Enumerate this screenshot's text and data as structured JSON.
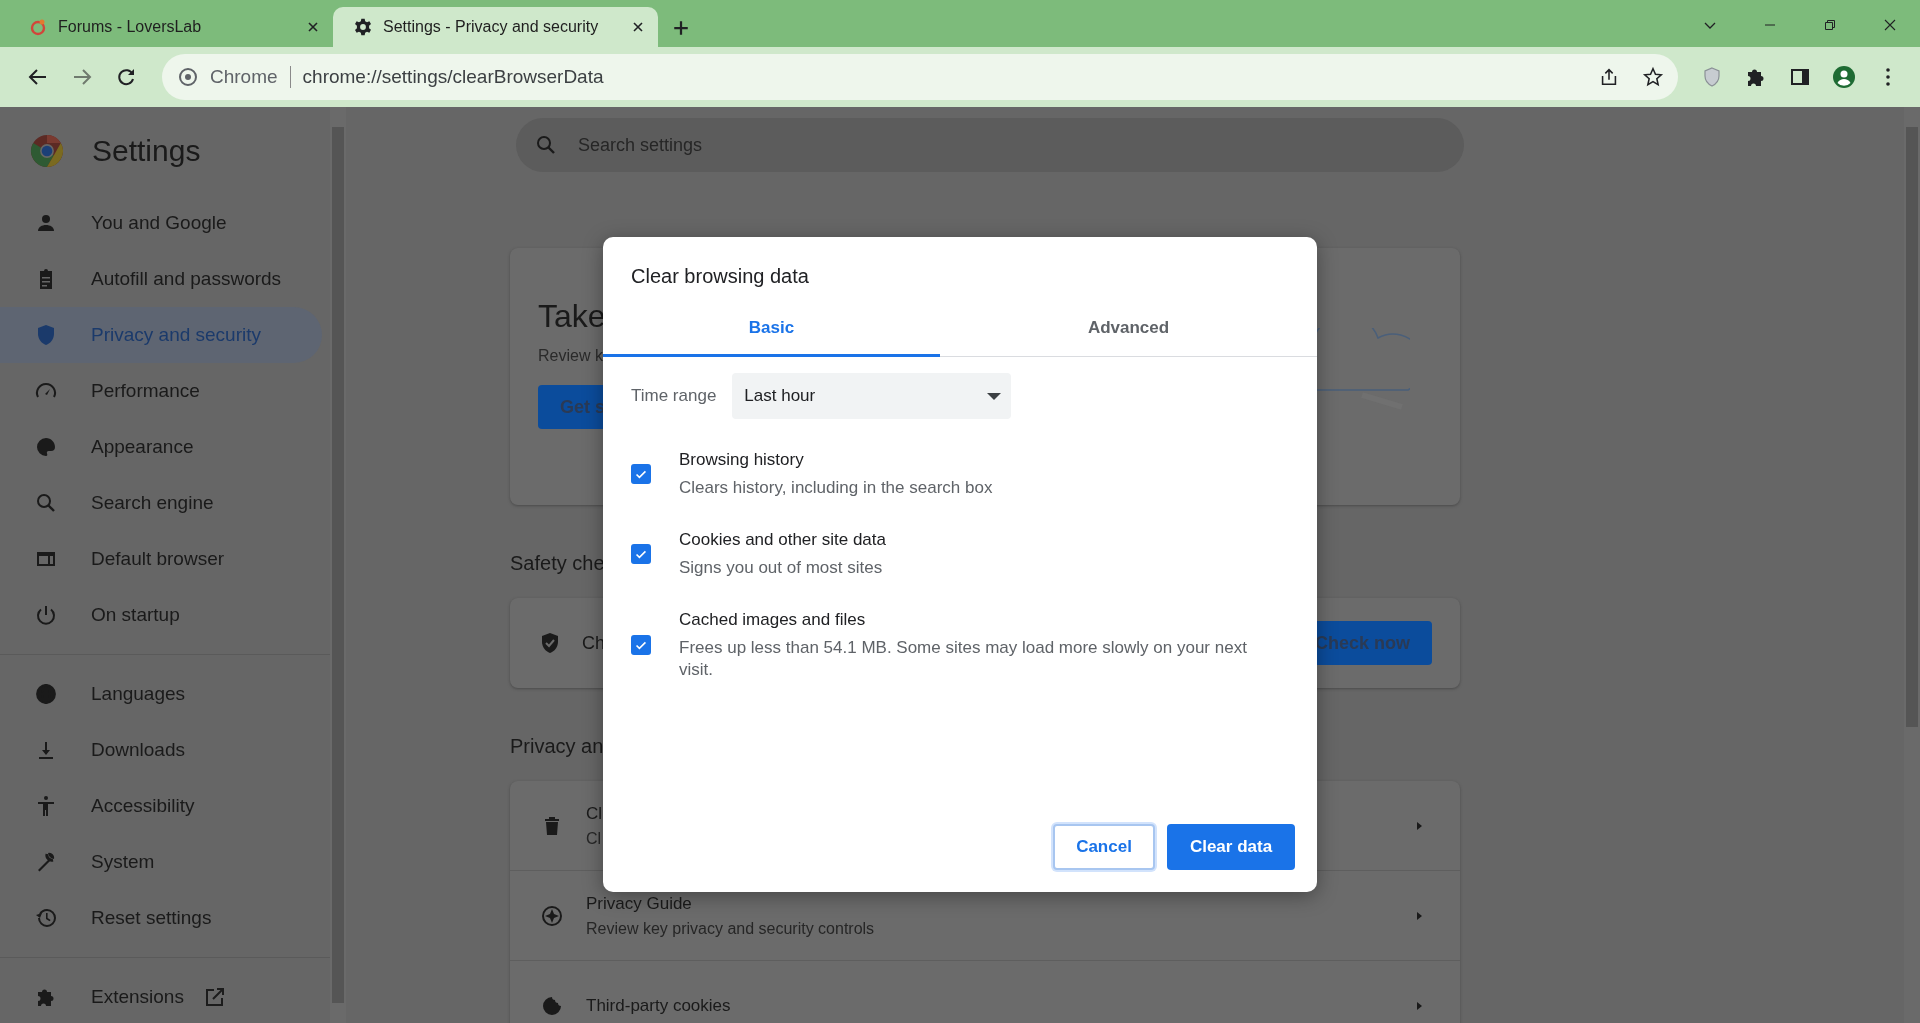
{
  "browser": {
    "tabs": [
      {
        "title": "Forums - LoversLab",
        "selected": false
      },
      {
        "title": "Settings - Privacy and security",
        "selected": true
      }
    ],
    "omnibox": {
      "site_label": "Chrome",
      "url": "chrome://settings/clearBrowserData"
    }
  },
  "settings": {
    "title": "Settings",
    "search_placeholder": "Search settings",
    "nav_groups": [
      [
        {
          "label": "You and Google",
          "selected": false,
          "kind": "page"
        },
        {
          "label": "Autofill and passwords",
          "selected": false,
          "kind": "page"
        },
        {
          "label": "Privacy and security",
          "selected": true,
          "kind": "page"
        },
        {
          "label": "Performance",
          "selected": false,
          "kind": "page"
        },
        {
          "label": "Appearance",
          "selected": false,
          "kind": "page"
        },
        {
          "label": "Search engine",
          "selected": false,
          "kind": "page"
        },
        {
          "label": "Default browser",
          "selected": false,
          "kind": "page"
        },
        {
          "label": "On startup",
          "selected": false,
          "kind": "page"
        }
      ],
      [
        {
          "label": "Languages",
          "selected": false,
          "kind": "page"
        },
        {
          "label": "Downloads",
          "selected": false,
          "kind": "page"
        },
        {
          "label": "Accessibility",
          "selected": false,
          "kind": "page"
        },
        {
          "label": "System",
          "selected": false,
          "kind": "page"
        },
        {
          "label": "Reset settings",
          "selected": false,
          "kind": "page"
        }
      ],
      [
        {
          "label": "Extensions",
          "selected": false,
          "kind": "external"
        }
      ]
    ],
    "promo_card": {
      "title": "Take",
      "text": "Review k",
      "button": "Get s"
    },
    "safety_heading": "Safety che",
    "safety_card": {
      "text": "Ch",
      "button": "Check now"
    },
    "privacy_heading": "Privacy an",
    "privacy_rows": [
      {
        "title": "Cl",
        "subtitle": "Cl"
      },
      {
        "title": "Privacy Guide",
        "subtitle": "Review key privacy and security controls"
      },
      {
        "title": "Third-party cookies"
      }
    ]
  },
  "dialog": {
    "title": "Clear browsing data",
    "tabs": [
      {
        "label": "Basic",
        "selected": true
      },
      {
        "label": "Advanced",
        "selected": false
      }
    ],
    "time_range": {
      "label": "Time range",
      "value": "Last hour"
    },
    "options": [
      {
        "title": "Browsing history",
        "description": "Clears history, including in the search box",
        "checked": true
      },
      {
        "title": "Cookies and other site data",
        "description": "Signs you out of most sites",
        "checked": true
      },
      {
        "title": "Cached images and files",
        "description": "Frees up less than 54.1 MB. Some sites may load more slowly on your next visit.",
        "checked": true
      }
    ],
    "buttons": [
      {
        "label": "Cancel",
        "kind": "secondary"
      },
      {
        "label": "Clear data",
        "kind": "primary"
      }
    ]
  }
}
